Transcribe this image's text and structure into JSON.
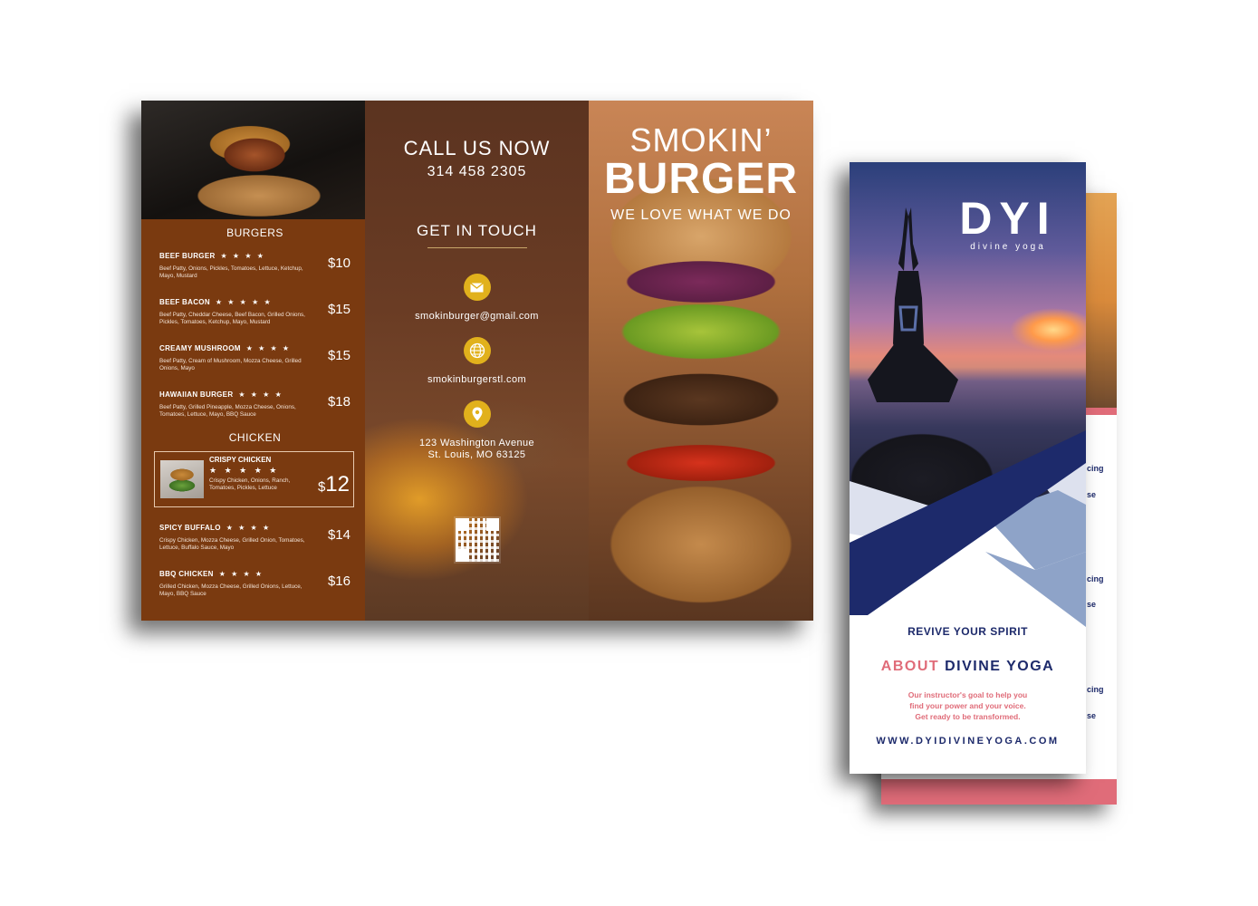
{
  "burger_brochure": {
    "menu": {
      "burgers_title": "BURGERS",
      "chicken_title": "CHICKEN",
      "burgers": [
        {
          "name": "BEEF BURGER",
          "stars": "★ ★ ★ ★",
          "desc": "Beef Patty, Onions, Pickles, Tomatoes, Lettuce, Ketchup, Mayo, Mustard",
          "price": "$10"
        },
        {
          "name": "BEEF BACON",
          "stars": "★ ★ ★ ★ ★",
          "desc": "Beef Patty, Cheddar Cheese, Beef Bacon, Grilled Onions, Pickles, Tomatoes, Ketchup, Mayo, Mustard",
          "price": "$15"
        },
        {
          "name": "CREAMY MUSHROOM",
          "stars": "★ ★ ★ ★",
          "desc": "Beef Patty, Cream of Mushroom, Mozza Cheese, Grilled Onions, Mayo",
          "price": "$15"
        },
        {
          "name": "HAWAIIAN BURGER",
          "stars": "★ ★ ★ ★",
          "desc": "Beef Patty, Grilled Pineapple, Mozza Cheese, Onions, Tomatoes, Lettuce, Mayo, BBQ Sauce",
          "price": "$18"
        }
      ],
      "featured": {
        "name": "CRISPY CHICKEN",
        "stars": "★ ★ ★ ★ ★",
        "desc": "Crispy Chicken, Onions, Ranch, Tomatoes, Pickles, Lettuce",
        "currency": "$",
        "price": "12"
      },
      "chicken": [
        {
          "name": "SPICY BUFFALO",
          "stars": "★ ★ ★ ★",
          "desc": "Crispy Chicken, Mozza Cheese, Grilled Onion, Tomatoes, Lettuce, Buffalo Sauce, Mayo",
          "price": "$14"
        },
        {
          "name": "BBQ CHICKEN",
          "stars": "★ ★ ★ ★",
          "desc": "Grilled Chicken, Mozza Cheese, Grilled Onions, Lettuce, Mayo, BBQ Sauce",
          "price": "$16"
        }
      ]
    },
    "contact": {
      "call_title": "CALL US NOW",
      "phone": "314 458 2305",
      "get_in_touch": "GET IN TOUCH",
      "email": "smokinburger@gmail.com",
      "website": "smokinburgerstl.com",
      "address_line1": "123 Washington Avenue",
      "address_line2": "St. Louis, MO 63125",
      "icons": [
        "mail-icon",
        "globe-icon",
        "location-pin-icon",
        "qr-code-icon"
      ],
      "icon_color": "#e1b11c"
    },
    "cover": {
      "title_line1": "SMOKIN’",
      "title_line2": "BURGER",
      "tagline": "WE LOVE WHAT WE DO"
    },
    "colors": {
      "menu_bg": "#7a3a10"
    }
  },
  "yoga_brochure": {
    "logo": "DYI",
    "logo_sub": "divine yoga",
    "revive": "REVIVE YOUR SPIRIT",
    "about_word1": "ABOUT",
    "about_word2": "DIVINE YOGA",
    "about_text_line1": "Our instructor's goal to help you",
    "about_text_line2": "find your power and your voice.",
    "about_text_line3": "Get ready to be transformed.",
    "url": "WWW.DYIDIVINEYOGA.COM",
    "back_fragments": [
      "cing",
      "se",
      "cing",
      "se",
      "cing",
      "se"
    ],
    "colors": {
      "navy": "#1d2a6b",
      "pink": "#e06c79",
      "light_blue": "#8ea3c8"
    }
  }
}
